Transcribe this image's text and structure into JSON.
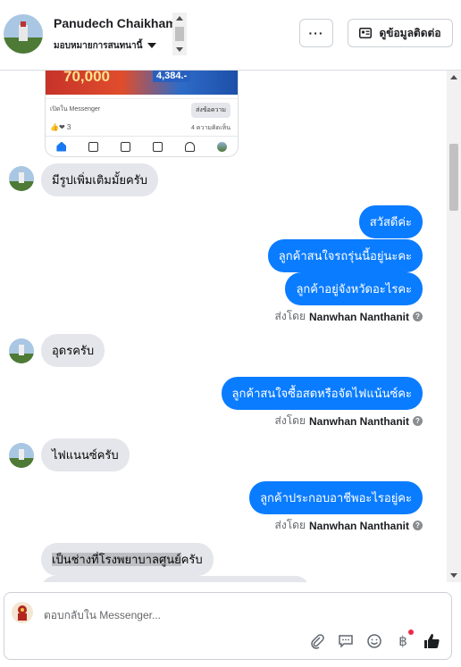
{
  "header": {
    "name": "Panudech Chaikham",
    "assign_label": "มอบหมายการสนทนานี้",
    "more_label": "···",
    "contact_button_label": "ดูข้อมูลติดต่อ"
  },
  "shared_post": {
    "banner_text": "70,000",
    "banner_price": "4,384.-",
    "open_in_messenger": "เปิดใน Messenger",
    "send_message": "ส่งข้อความ",
    "reactions_count": "3",
    "comments_text": "4 ความคิดเห็น"
  },
  "messages": [
    {
      "dir": "in",
      "text": "มีรูปเพิ่มเติมมั้ยครับ"
    },
    {
      "dir": "out",
      "text": "สวัสดีค่ะ"
    },
    {
      "dir": "out",
      "text": "ลูกค้าสนใจรถรุ่นนี้อยู่นะคะ"
    },
    {
      "dir": "out",
      "text": "ลูกค้าอยู่จังหวัดอะไรคะ"
    },
    {
      "dir": "in",
      "text": "อุดรครับ"
    },
    {
      "dir": "out",
      "text": "ลูกค้าสนใจซื้อสดหรือจัดไฟแน้นซ์คะ"
    },
    {
      "dir": "in",
      "text": "ไฟแนนซ์ครับ"
    },
    {
      "dir": "out",
      "text": "ลูกค้าประกอบอาชีพอะไรอยู่คะ"
    },
    {
      "dir": "in",
      "text_highlight": "เป็นช่างที่โรงพยาบาลศูนย์",
      "text_rest": "ครับ"
    }
  ],
  "sent_by": {
    "prefix": "ส่งโดย",
    "agent": "Nanwhan Nanthanit"
  },
  "composer": {
    "placeholder": "ตอบกลับใน Messenger..."
  },
  "colors": {
    "outgoing_bubble": "#0a7cff",
    "incoming_bubble": "#e4e6eb",
    "like_icon": "#1c1e21",
    "notification_dot": "#f02849"
  },
  "icons": [
    "more-icon",
    "contact-card-icon",
    "help-icon",
    "attach-icon",
    "comment-icon",
    "emoji-icon",
    "baht-icon",
    "like-icon"
  ]
}
